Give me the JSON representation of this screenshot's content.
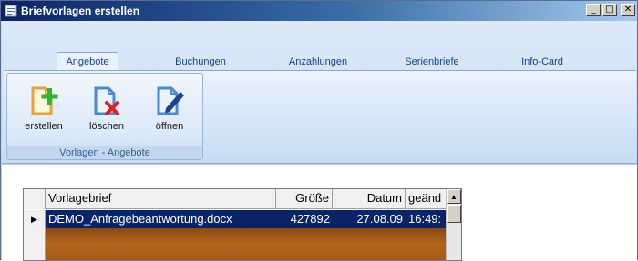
{
  "window": {
    "title": "Briefvorlagen erstellen",
    "buttons": {
      "minimize": "_",
      "maximize": "□",
      "close": "✕"
    }
  },
  "ribbon": {
    "tabs": [
      {
        "label": "Angebote",
        "active": true
      },
      {
        "label": "Buchungen",
        "active": false
      },
      {
        "label": "Anzahlungen",
        "active": false
      },
      {
        "label": "Serienbriefe",
        "active": false
      },
      {
        "label": "Info-Card",
        "active": false
      }
    ],
    "group": {
      "caption": "Vorlagen - Angebote",
      "commands": [
        {
          "label": "erstellen",
          "icon": "document-add-icon"
        },
        {
          "label": "löschen",
          "icon": "document-delete-icon"
        },
        {
          "label": "öffnen",
          "icon": "document-edit-icon"
        }
      ]
    }
  },
  "grid": {
    "columns": [
      "Vorlagebrief",
      "Größe",
      "Datum",
      "geänd"
    ],
    "rows": [
      {
        "Vorlagebrief": "DEMO_Anfragebeantwortung.docx",
        "Größe": "427892",
        "Datum": "27.08.09",
        "geänd": "16:49:"
      }
    ],
    "current_row_marker": "▶",
    "scroll_up": "▲"
  },
  "colors": {
    "titlebar_start": "#0a246a",
    "ribbon_bg": "#dde9f8",
    "selection": "#0a246a",
    "accent_add": "#2eb82e",
    "accent_delete": "#e02020",
    "accent_edit": "#1f3f8f",
    "doc_orange": "#f0a030",
    "doc_blue": "#4a8ad0"
  }
}
